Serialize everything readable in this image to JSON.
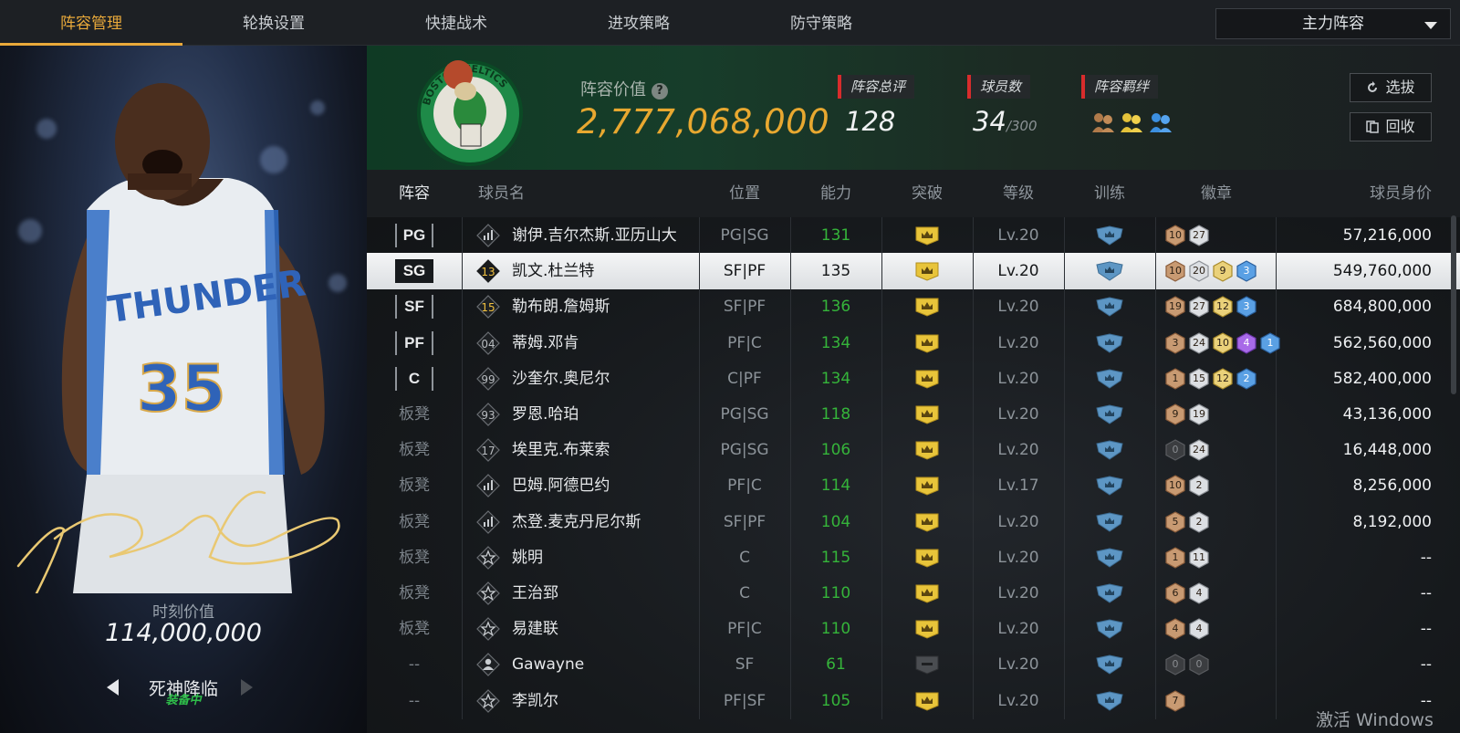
{
  "nav": {
    "tabs": [
      {
        "label": "阵容管理",
        "active": true
      },
      {
        "label": "轮换设置",
        "active": false
      },
      {
        "label": "快捷战术",
        "active": false
      },
      {
        "label": "进攻策略",
        "active": false
      },
      {
        "label": "防守策略",
        "active": false
      }
    ],
    "lineup_select": "主力阵容"
  },
  "card": {
    "moment_label": "时刻价值",
    "moment_value": "114,000,000",
    "name": "死神降临",
    "status": "装备中",
    "jersey_text": "THUNDER",
    "jersey_number": "35"
  },
  "summary": {
    "value_label": "阵容价值",
    "help": "?",
    "value": "2,777,068,000",
    "overall_label": "阵容总评",
    "overall": "128",
    "players_label": "球员数",
    "players": "34",
    "players_max": "/300",
    "bond_label": "阵容羁绊",
    "btn_scout": "选拔",
    "btn_recycle": "回收",
    "logo_text": "BOSTON CELTICS"
  },
  "colors": {
    "accent": "#e9a93a",
    "value_gold": "#e8a830",
    "rating_green": "#35b43a",
    "status_green": "#2fbe4a",
    "red_marker": "#d82c2c"
  },
  "table": {
    "headers": [
      "阵容",
      "球员名",
      "位置",
      "能力",
      "突破",
      "等级",
      "训练",
      "徽章",
      "球员身价"
    ],
    "rows": [
      {
        "slot": "PG",
        "starter": true,
        "icon": "bars-icon",
        "num": "",
        "name": "谢伊.吉尔杰斯.亚历山大",
        "pos": "PG|SG",
        "ovr": "131",
        "lvl": "Lv.20",
        "breakout": true,
        "badges": [
          [
            "10",
            "bronze"
          ],
          [
            "27",
            "silver"
          ]
        ],
        "price": "57,216,000",
        "selected": false
      },
      {
        "slot": "SG",
        "starter": true,
        "icon": "jersey-number",
        "num": "13",
        "name": "凯文.杜兰特",
        "pos": "SF|PF",
        "ovr": "135",
        "lvl": "Lv.20",
        "breakout": true,
        "badges": [
          [
            "10",
            "bronze"
          ],
          [
            "20",
            "silver"
          ],
          [
            "9",
            "gold"
          ],
          [
            "3",
            "blue"
          ]
        ],
        "price": "549,760,000",
        "selected": true
      },
      {
        "slot": "SF",
        "starter": true,
        "icon": "jersey-number",
        "num": "15",
        "name": "勒布朗.詹姆斯",
        "pos": "SF|PF",
        "ovr": "136",
        "lvl": "Lv.20",
        "breakout": true,
        "badges": [
          [
            "19",
            "bronze"
          ],
          [
            "27",
            "silver"
          ],
          [
            "12",
            "gold"
          ],
          [
            "3",
            "blue"
          ]
        ],
        "price": "684,800,000",
        "selected": false
      },
      {
        "slot": "PF",
        "starter": true,
        "icon": "jersey-number",
        "num": "04",
        "name": "蒂姆.邓肯",
        "pos": "PF|C",
        "ovr": "134",
        "lvl": "Lv.20",
        "breakout": true,
        "badges": [
          [
            "3",
            "bronze"
          ],
          [
            "24",
            "silver"
          ],
          [
            "10",
            "gold"
          ],
          [
            "4",
            "purple"
          ],
          [
            "1",
            "blue"
          ]
        ],
        "price": "562,560,000",
        "selected": false
      },
      {
        "slot": "C",
        "starter": true,
        "icon": "jersey-number",
        "num": "99",
        "name": "沙奎尔.奥尼尔",
        "pos": "C|PF",
        "ovr": "134",
        "lvl": "Lv.20",
        "breakout": true,
        "badges": [
          [
            "1",
            "bronze"
          ],
          [
            "15",
            "silver"
          ],
          [
            "12",
            "gold"
          ],
          [
            "2",
            "blue"
          ]
        ],
        "price": "582,400,000",
        "selected": false
      },
      {
        "slot": "板凳",
        "starter": false,
        "icon": "jersey-number",
        "num": "93",
        "name": "罗恩.哈珀",
        "pos": "PG|SG",
        "ovr": "118",
        "lvl": "Lv.20",
        "breakout": true,
        "badges": [
          [
            "9",
            "bronze"
          ],
          [
            "19",
            "silver"
          ]
        ],
        "price": "43,136,000",
        "selected": false
      },
      {
        "slot": "板凳",
        "starter": false,
        "icon": "jersey-number",
        "num": "17",
        "name": "埃里克.布莱索",
        "pos": "PG|SG",
        "ovr": "106",
        "lvl": "Lv.20",
        "breakout": true,
        "badges": [
          [
            "0",
            "dark"
          ],
          [
            "24",
            "silver"
          ]
        ],
        "price": "16,448,000",
        "selected": false
      },
      {
        "slot": "板凳",
        "starter": false,
        "icon": "bars-icon",
        "num": "",
        "name": "巴姆.阿德巴约",
        "pos": "PF|C",
        "ovr": "114",
        "lvl": "Lv.17",
        "breakout": true,
        "badges": [
          [
            "10",
            "bronze"
          ],
          [
            "2",
            "silver"
          ]
        ],
        "price": "8,256,000",
        "selected": false
      },
      {
        "slot": "板凳",
        "starter": false,
        "icon": "bars-icon",
        "num": "",
        "name": "杰登.麦克丹尼尔斯",
        "pos": "SF|PF",
        "ovr": "104",
        "lvl": "Lv.20",
        "breakout": true,
        "badges": [
          [
            "5",
            "bronze"
          ],
          [
            "2",
            "silver"
          ]
        ],
        "price": "8,192,000",
        "selected": false
      },
      {
        "slot": "板凳",
        "starter": false,
        "icon": "star-icon",
        "num": "",
        "name": "姚明",
        "pos": "C",
        "ovr": "115",
        "lvl": "Lv.20",
        "breakout": true,
        "badges": [
          [
            "1",
            "bronze"
          ],
          [
            "11",
            "silver"
          ]
        ],
        "price": "--",
        "selected": false
      },
      {
        "slot": "板凳",
        "starter": false,
        "icon": "star-icon",
        "num": "",
        "name": "王治郅",
        "pos": "C",
        "ovr": "110",
        "lvl": "Lv.20",
        "breakout": true,
        "badges": [
          [
            "6",
            "bronze"
          ],
          [
            "4",
            "silver"
          ]
        ],
        "price": "--",
        "selected": false
      },
      {
        "slot": "板凳",
        "starter": false,
        "icon": "star-icon",
        "num": "",
        "name": "易建联",
        "pos": "PF|C",
        "ovr": "110",
        "lvl": "Lv.20",
        "breakout": true,
        "badges": [
          [
            "4",
            "bronze"
          ],
          [
            "4",
            "silver"
          ]
        ],
        "price": "--",
        "selected": false
      },
      {
        "slot": "--",
        "starter": false,
        "icon": "person-icon",
        "num": "",
        "name": "Gawayne",
        "pos": "SF",
        "ovr": "61",
        "lvl": "Lv.20",
        "breakout": false,
        "badges": [
          [
            "0",
            "dark"
          ],
          [
            "0",
            "dark"
          ]
        ],
        "price": "--",
        "selected": false
      },
      {
        "slot": "--",
        "starter": false,
        "icon": "star-icon",
        "num": "",
        "name": "李凯尔",
        "pos": "PF|SF",
        "ovr": "105",
        "lvl": "Lv.20",
        "breakout": true,
        "badges": [
          [
            "7",
            "bronze"
          ]
        ],
        "price": "--",
        "selected": false
      }
    ]
  },
  "watermark": "激活 Windows"
}
